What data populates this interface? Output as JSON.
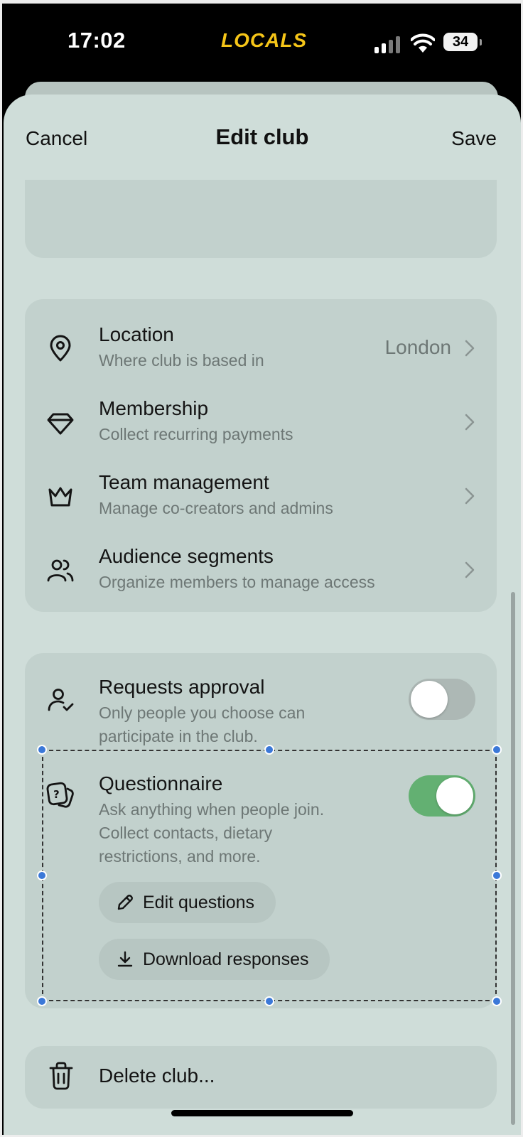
{
  "status_bar": {
    "time": "17:02",
    "logo": "LOCALS",
    "battery": "34"
  },
  "header": {
    "cancel_label": "Cancel",
    "title": "Edit club",
    "save_label": "Save"
  },
  "settings": [
    {
      "title": "Location",
      "subtitle": "Where club is based in",
      "value": "London",
      "icon": "map-pin-icon"
    },
    {
      "title": "Membership",
      "subtitle": "Collect recurring payments",
      "value": "",
      "icon": "diamond-icon"
    },
    {
      "title": "Team management",
      "subtitle": "Manage co-creators and admins",
      "value": "",
      "icon": "crown-icon"
    },
    {
      "title": "Audience segments",
      "subtitle": "Organize members to manage access",
      "value": "",
      "icon": "users-icon"
    }
  ],
  "access": {
    "requests": {
      "title": "Requests approval",
      "subtitle_lines": [
        "Only people you choose can",
        "participate in the club."
      ],
      "enabled": false
    },
    "questionnaire": {
      "title": "Questionnaire",
      "subtitle_lines": [
        "Ask anything when people join.",
        "Collect contacts, dietary",
        "restrictions, and more."
      ],
      "enabled": true,
      "edit_label": "Edit questions",
      "download_label": "Download responses"
    }
  },
  "delete_label": "Delete club...",
  "colors": {
    "sheet": "#cfddd9",
    "card": "#c2d1cd",
    "toggle_on": "#63b072",
    "logo": "#f5c518",
    "handle": "#3b78d8"
  }
}
